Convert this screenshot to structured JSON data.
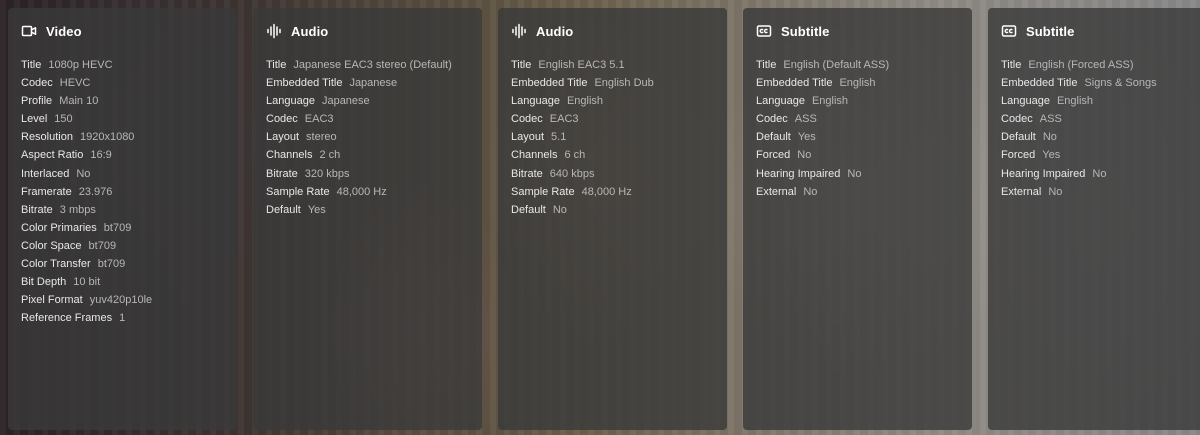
{
  "panels": [
    {
      "icon": "video-camera-icon",
      "title": "Video",
      "rows": [
        {
          "label": "Title",
          "value": "1080p HEVC"
        },
        {
          "label": "Codec",
          "value": "HEVC"
        },
        {
          "label": "Profile",
          "value": "Main 10"
        },
        {
          "label": "Level",
          "value": "150"
        },
        {
          "label": "Resolution",
          "value": "1920x1080"
        },
        {
          "label": "Aspect Ratio",
          "value": "16:9"
        },
        {
          "label": "Interlaced",
          "value": "No"
        },
        {
          "label": "Framerate",
          "value": "23.976"
        },
        {
          "label": "Bitrate",
          "value": "3 mbps"
        },
        {
          "label": "Color Primaries",
          "value": "bt709"
        },
        {
          "label": "Color Space",
          "value": "bt709"
        },
        {
          "label": "Color Transfer",
          "value": "bt709"
        },
        {
          "label": "Bit Depth",
          "value": "10 bit"
        },
        {
          "label": "Pixel Format",
          "value": "yuv420p10le"
        },
        {
          "label": "Reference Frames",
          "value": "1"
        }
      ]
    },
    {
      "icon": "audio-waveform-icon",
      "title": "Audio",
      "rows": [
        {
          "label": "Title",
          "value": "Japanese EAC3 stereo (Default)"
        },
        {
          "label": "Embedded Title",
          "value": "Japanese"
        },
        {
          "label": "Language",
          "value": "Japanese"
        },
        {
          "label": "Codec",
          "value": "EAC3"
        },
        {
          "label": "Layout",
          "value": "stereo"
        },
        {
          "label": "Channels",
          "value": "2 ch"
        },
        {
          "label": "Bitrate",
          "value": "320 kbps"
        },
        {
          "label": "Sample Rate",
          "value": "48,000 Hz"
        },
        {
          "label": "Default",
          "value": "Yes"
        }
      ]
    },
    {
      "icon": "audio-waveform-icon",
      "title": "Audio",
      "rows": [
        {
          "label": "Title",
          "value": "English EAC3 5.1"
        },
        {
          "label": "Embedded Title",
          "value": "English Dub"
        },
        {
          "label": "Language",
          "value": "English"
        },
        {
          "label": "Codec",
          "value": "EAC3"
        },
        {
          "label": "Layout",
          "value": "5.1"
        },
        {
          "label": "Channels",
          "value": "6 ch"
        },
        {
          "label": "Bitrate",
          "value": "640 kbps"
        },
        {
          "label": "Sample Rate",
          "value": "48,000 Hz"
        },
        {
          "label": "Default",
          "value": "No"
        }
      ]
    },
    {
      "icon": "closed-caption-icon",
      "title": "Subtitle",
      "rows": [
        {
          "label": "Title",
          "value": "English (Default ASS)"
        },
        {
          "label": "Embedded Title",
          "value": "English"
        },
        {
          "label": "Language",
          "value": "English"
        },
        {
          "label": "Codec",
          "value": "ASS"
        },
        {
          "label": "Default",
          "value": "Yes"
        },
        {
          "label": "Forced",
          "value": "No"
        },
        {
          "label": "Hearing Impaired",
          "value": "No"
        },
        {
          "label": "External",
          "value": "No"
        }
      ]
    },
    {
      "icon": "closed-caption-icon",
      "title": "Subtitle",
      "rows": [
        {
          "label": "Title",
          "value": "English (Forced ASS)"
        },
        {
          "label": "Embedded Title",
          "value": "Signs & Songs"
        },
        {
          "label": "Language",
          "value": "English"
        },
        {
          "label": "Codec",
          "value": "ASS"
        },
        {
          "label": "Default",
          "value": "No"
        },
        {
          "label": "Forced",
          "value": "Yes"
        },
        {
          "label": "Hearing Impaired",
          "value": "No"
        },
        {
          "label": "External",
          "value": "No"
        }
      ]
    }
  ]
}
